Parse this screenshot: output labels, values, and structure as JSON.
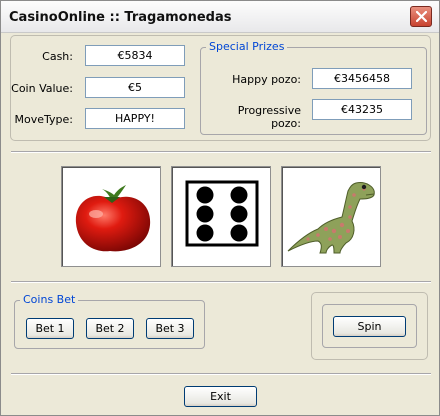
{
  "window": {
    "title": "CasinoOnline :: Tragamonedas"
  },
  "player": {
    "cash_label": "Cash:",
    "cash_value": "€5834",
    "coin_label": "Coin Value:",
    "coin_value": "€5",
    "move_label": "MoveType:",
    "move_value": "HAPPY!"
  },
  "prizes": {
    "legend": "Special Prizes",
    "happy_label": "Happy pozo:",
    "happy_value": "€3456458",
    "progressive_label": "Progressive pozo:",
    "progressive_value": "€43235"
  },
  "reels": [
    {
      "symbol": "tomato-icon"
    },
    {
      "symbol": "dice-six-icon"
    },
    {
      "symbol": "dinosaur-icon"
    }
  ],
  "bet": {
    "legend": "Coins Bet",
    "bet1": "Bet 1",
    "bet2": "Bet 2",
    "bet3": "Bet 3"
  },
  "spin": {
    "label": "Spin"
  },
  "exit": {
    "label": "Exit"
  },
  "colors": {
    "accent": "#0046d5",
    "face": "#ece9d8",
    "close": "#c8432f"
  }
}
